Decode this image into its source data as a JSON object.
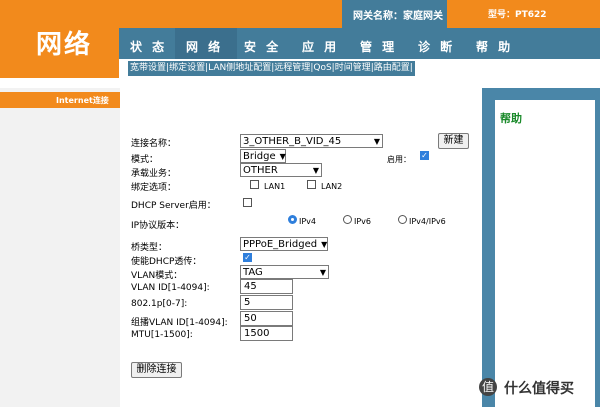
{
  "header": {
    "logo": "网络",
    "gateway_name": "网关名称：家庭网关",
    "model": "型号：PT622",
    "nav": [
      "状 态",
      "网 络",
      "安 全",
      "应 用",
      "管 理",
      "诊 断",
      "帮 助"
    ],
    "sub_links": [
      "宽带设置",
      "绑定设置",
      "LAN侧地址配置",
      "远程管理",
      "QoS",
      "时间管理",
      "路由配置"
    ]
  },
  "sidebar": {
    "active_item": "Internet连接"
  },
  "help": {
    "title": "帮助"
  },
  "form": {
    "connection_name_label": "连接名称：",
    "connection_name_value": "3_OTHER_B_VID_45",
    "new_button": "新建",
    "mode_label": "模式：",
    "mode_value": "Bridge",
    "enable_label": "启用：",
    "enable_checked": true,
    "service_label": "承载业务：",
    "service_value": "OTHER",
    "bind_label": "绑定选项：",
    "bind_options": [
      "LAN1",
      "LAN2"
    ],
    "dhcp_server_label": "DHCP Server启用：",
    "dhcp_server_checked": false,
    "ip_version_label": "IP协议版本：",
    "ip_versions": [
      "IPv4",
      "IPv6",
      "IPv4/IPv6"
    ],
    "ip_version_selected": "IPv4",
    "bridge_type_label": "桥类型：",
    "bridge_type_value": "PPPoE_Bridged",
    "dhcp_passthrough_label": "使能DHCP透传：",
    "dhcp_passthrough_checked": true,
    "vlan_mode_label": "VLAN模式：",
    "vlan_mode_value": "TAG",
    "vlan_id_label": "VLAN ID[1-4094]:",
    "vlan_id_value": "45",
    "priority_label": "802.1p[0-7]:",
    "priority_value": "5",
    "mcast_vlan_label": "组播VLAN ID[1-4094]:",
    "mcast_vlan_value": "50",
    "mtu_label": "MTU[1-1500]:",
    "mtu_value": "1500",
    "delete_button": "删除连接"
  },
  "watermark": {
    "text": "什么值得买",
    "glyph": "值"
  }
}
